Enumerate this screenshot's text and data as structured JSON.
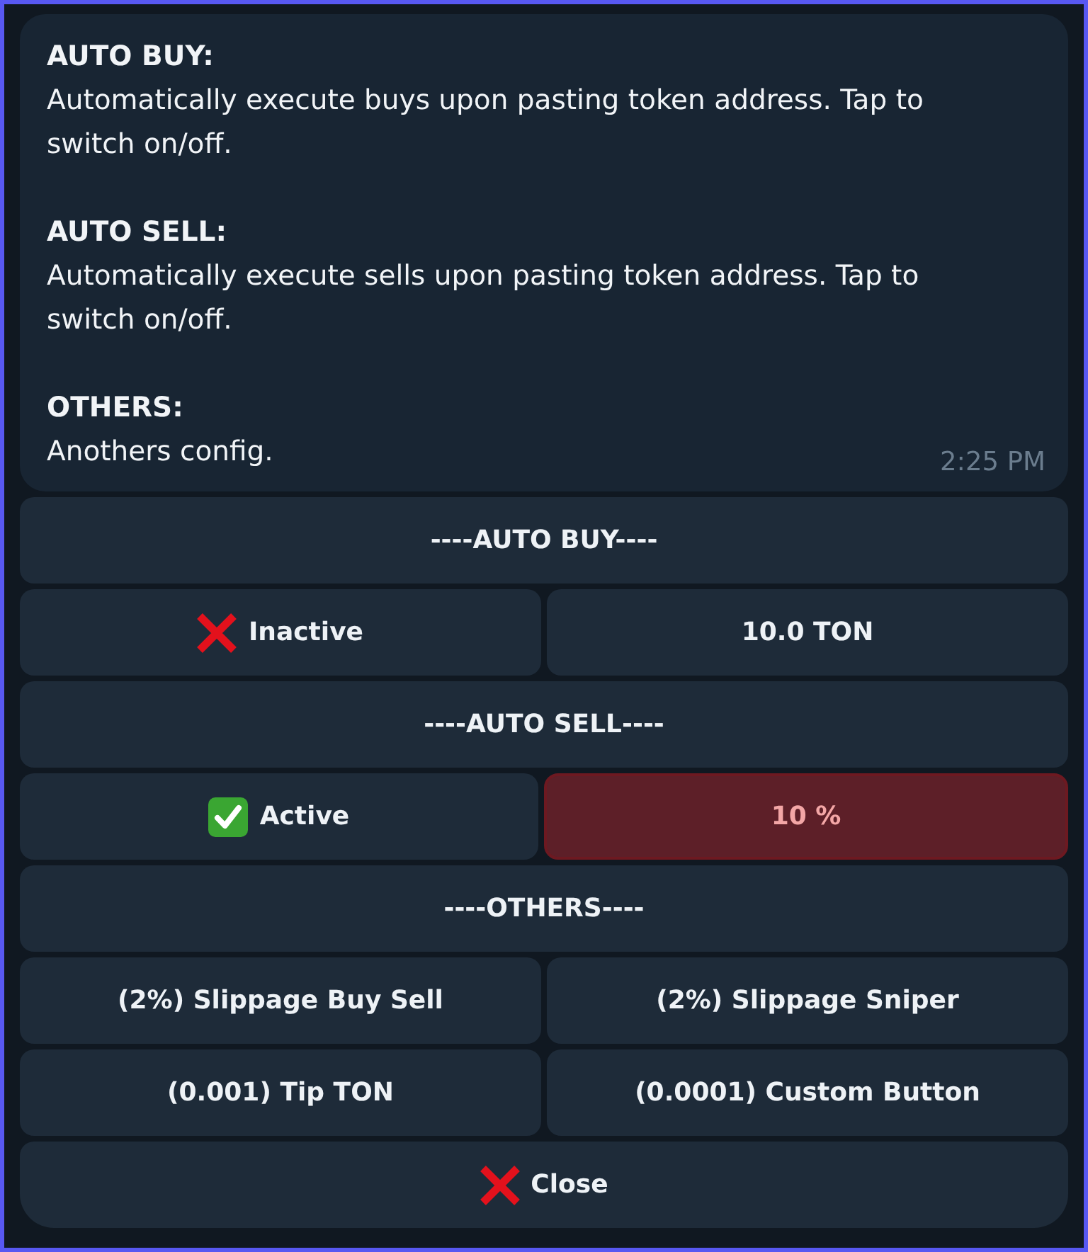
{
  "message": {
    "sections": [
      {
        "heading": "AUTO BUY:",
        "body": "Automatically execute buys upon pasting token address. Tap to switch on/off."
      },
      {
        "heading": "AUTO SELL:",
        "body": "Automatically execute sells upon pasting token address. Tap to switch on/off."
      },
      {
        "heading": "OTHERS:",
        "body": "Anothers config."
      }
    ],
    "time": "2:25 PM"
  },
  "keyboard": {
    "rows": [
      {
        "buttons": [
          {
            "kind": "plain",
            "label": "----AUTO BUY----",
            "highlighted": false
          }
        ]
      },
      {
        "buttons": [
          {
            "kind": "toggle",
            "on": false,
            "label": "Inactive",
            "highlighted": false
          },
          {
            "kind": "plain",
            "label": "10.0 TON",
            "highlighted": false
          }
        ]
      },
      {
        "buttons": [
          {
            "kind": "plain",
            "label": "----AUTO SELL----",
            "highlighted": false
          }
        ]
      },
      {
        "buttons": [
          {
            "kind": "toggle",
            "on": true,
            "label": "Active",
            "highlighted": false
          },
          {
            "kind": "plain",
            "label": "10 %",
            "highlighted": true
          }
        ]
      },
      {
        "buttons": [
          {
            "kind": "plain",
            "label": "----OTHERS----",
            "highlighted": false
          }
        ]
      },
      {
        "buttons": [
          {
            "kind": "plain",
            "label": "(2%) Slippage Buy Sell",
            "highlighted": false
          },
          {
            "kind": "plain",
            "label": "(2%) Slippage Sniper",
            "highlighted": false
          }
        ]
      },
      {
        "buttons": [
          {
            "kind": "plain",
            "label": "(0.001) Tip TON",
            "highlighted": false
          },
          {
            "kind": "plain",
            "label": "(0.0001) Custom Button",
            "highlighted": false
          }
        ]
      },
      {
        "buttons": [
          {
            "kind": "close",
            "label": "Close",
            "highlighted": false
          }
        ]
      }
    ]
  }
}
